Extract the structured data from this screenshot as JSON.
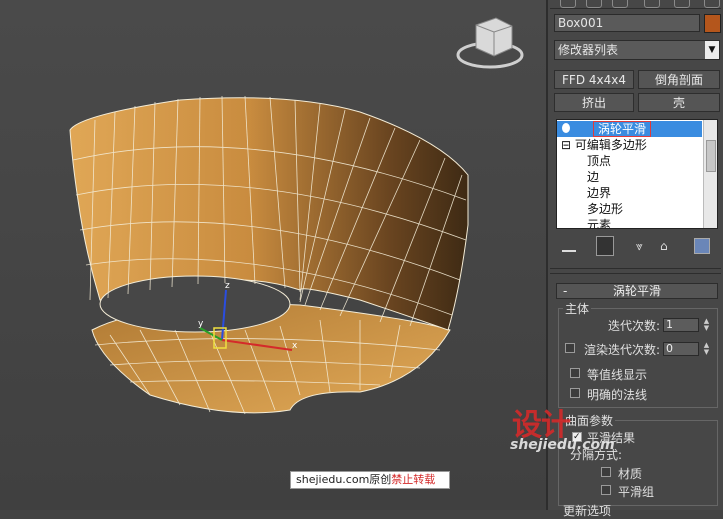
{
  "object_name": "Box001",
  "object_color": "#b4561c",
  "modifier_list": "修改器列表",
  "buttons": {
    "ffd": "FFD 4x4x4",
    "chamfer": "倒角剖面",
    "extrude": "挤出",
    "shell": "壳"
  },
  "stack": {
    "items": [
      {
        "label": "涡轮平滑",
        "selected": true
      },
      {
        "label": "可编辑多边形",
        "expander": "⊟"
      },
      {
        "label": "顶点"
      },
      {
        "label": "边"
      },
      {
        "label": "边界"
      },
      {
        "label": "多边形"
      },
      {
        "label": "元素"
      }
    ]
  },
  "turbosmooth": {
    "title": "涡轮平滑",
    "collapse": "-",
    "main_group": "主体",
    "iterations_label": "迭代次数:",
    "iterations_value": "1",
    "render_iters_label": "渲染迭代次数:",
    "render_iters_value": "0",
    "isoline": "等值线显示",
    "explicit_normals": "明确的法线",
    "surface_group": "曲面参数",
    "smooth_result": "平滑结果",
    "separate_by": "分隔方式:",
    "materials": "材质",
    "smoothing_groups": "平滑组",
    "update_group": "更新选项"
  },
  "gizmo": {
    "x": "x",
    "y": "y",
    "z": "z"
  },
  "watermark": {
    "site": "shejiedu.com原创",
    "warning": "禁止转载",
    "brand": "设计",
    "brand_url": "shejiedu.com"
  },
  "colors": {
    "mesh": "#c08a3e",
    "selected": "#3a8ce0",
    "viewport": "#454545",
    "wire": "#f5f0e0"
  }
}
